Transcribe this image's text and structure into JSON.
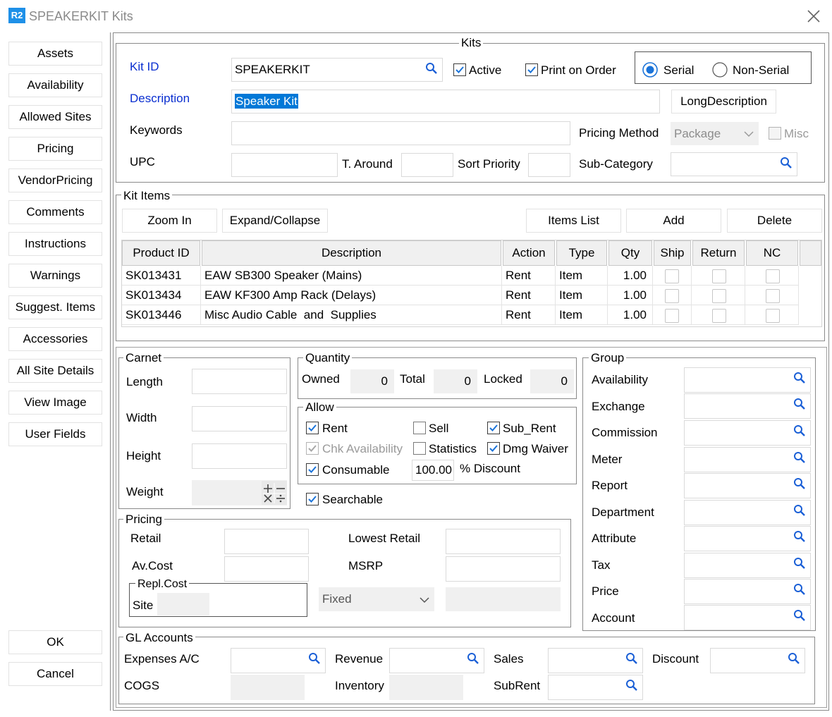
{
  "window": {
    "app_badge": "R2",
    "title": "SPEAKERKIT Kits"
  },
  "sidebar": {
    "items": [
      "Assets",
      "Availability",
      "Allowed Sites",
      "Pricing",
      "VendorPricing",
      "Comments",
      "Instructions",
      "Warnings",
      "Suggest. Items",
      "Accessories",
      "All Site Details",
      "View Image",
      "User Fields"
    ],
    "ok": "OK",
    "cancel": "Cancel"
  },
  "kits": {
    "legend": "Kits",
    "kit_id_label": "Kit ID",
    "kit_id_value": "SPEAKERKIT",
    "active_label": "Active",
    "active_checked": true,
    "print_on_order_label": "Print on Order",
    "print_on_order_checked": true,
    "serial_label": "Serial",
    "non_serial_label": "Non-Serial",
    "serial_selected": true,
    "description_label": "Description",
    "description_value": "Speaker Kit",
    "long_description_button": "LongDescription",
    "keywords_label": "Keywords",
    "keywords_value": "",
    "pricing_method_label": "Pricing Method",
    "pricing_method_value": "Package",
    "misc_label": "Misc",
    "upc_label": "UPC",
    "turnaround_label": "T. Around",
    "sort_priority_label": "Sort Priority",
    "sub_category_label": "Sub-Category"
  },
  "kit_items": {
    "legend": "Kit Items",
    "zoom_in": "Zoom In",
    "expand_collapse": "Expand/Collapse",
    "items_list": "Items List",
    "add": "Add",
    "delete": "Delete",
    "columns": [
      "Product ID",
      "Description",
      "Action",
      "Type",
      "Qty",
      "Ship",
      "Return",
      "NC"
    ],
    "rows": [
      {
        "product_id": "SK013431",
        "description": "EAW SB300 Speaker (Mains)",
        "action": "Rent",
        "type": "Item",
        "qty": "1.00"
      },
      {
        "product_id": "SK013434",
        "description": "EAW KF300 Amp Rack (Delays)",
        "action": "Rent",
        "type": "Item",
        "qty": "1.00"
      },
      {
        "product_id": "SK013446",
        "description": "Misc Audio Cable  and  Supplies",
        "action": "Rent",
        "type": "Item",
        "qty": "1.00"
      }
    ]
  },
  "carnet": {
    "legend": "Carnet",
    "length": "Length",
    "width": "Width",
    "height": "Height",
    "weight": "Weight"
  },
  "quantity": {
    "legend": "Quantity",
    "owned_label": "Owned",
    "owned": "0",
    "total_label": "Total",
    "total": "0",
    "locked_label": "Locked",
    "locked": "0"
  },
  "allow": {
    "legend": "Allow",
    "rent": "Rent",
    "sell": "Sell",
    "sub_rent": "Sub_Rent",
    "chk_availability": "Chk Availability",
    "statistics": "Statistics",
    "dmg_waiver": "Dmg Waiver",
    "consumable": "Consumable",
    "discount_value": "100.00",
    "discount_label": "% Discount"
  },
  "searchable": "Searchable",
  "pricing": {
    "legend": "Pricing",
    "retail": "Retail",
    "av_cost": "Av.Cost",
    "lowest_retail": "Lowest Retail",
    "msrp": "MSRP",
    "repl_cost_legend": "Repl.Cost",
    "site": "Site",
    "fixed": "Fixed"
  },
  "group": {
    "legend": "Group",
    "items": [
      "Availability",
      "Exchange",
      "Commission",
      "Meter",
      "Report",
      "Department",
      "Attribute",
      "Tax",
      "Price",
      "Account"
    ]
  },
  "gl": {
    "legend": "GL Accounts",
    "expenses": "Expenses A/C",
    "revenue": "Revenue",
    "sales": "Sales",
    "discount": "Discount",
    "cogs": "COGS",
    "inventory": "Inventory",
    "subrent": "SubRent"
  },
  "colors": {
    "accent": "#0078d7",
    "label_blue": "#0a2fd0",
    "selection": "#0078d7"
  }
}
